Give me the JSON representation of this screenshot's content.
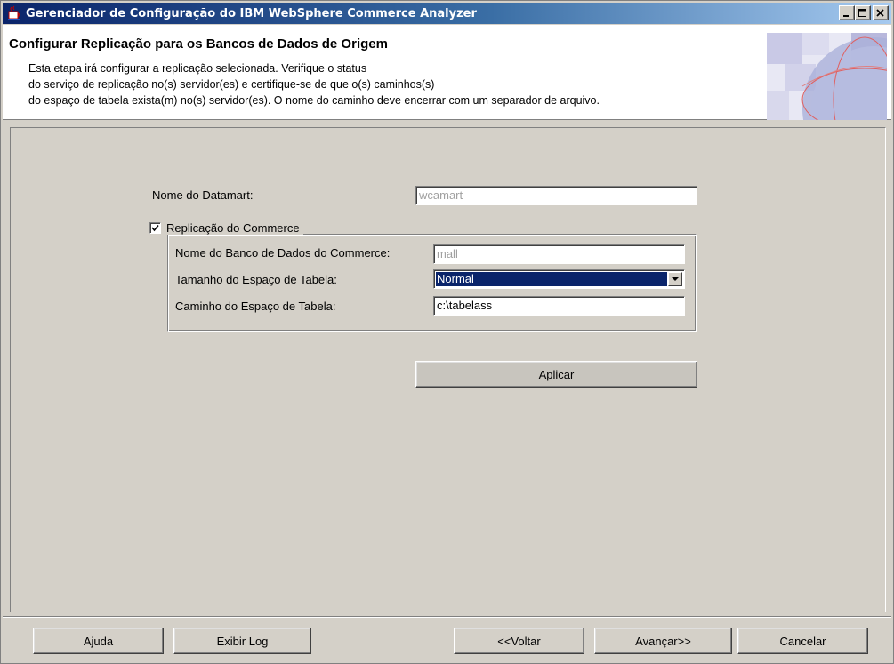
{
  "window": {
    "title": "Gerenciador de Configuração do IBM WebSphere Commerce Analyzer",
    "minimize_label": "_",
    "maximize_label": "□",
    "close_label": "X"
  },
  "header": {
    "title": "Configurar Replicação para os Bancos de Dados de Origem",
    "desc_line1": "Esta etapa irá configurar a replicação selecionada. Verifique o status",
    "desc_line2": "do serviço de replicação no(s) servidor(es) e certifique-se de que o(s) caminhos(s)",
    "desc_line3": "do espaço de tabela exista(m) no(s) servidor(es). O nome do caminho deve encerrar com um separador de arquivo."
  },
  "form": {
    "datamart_label": "Nome do Datamart:",
    "datamart_value": "wcamart",
    "replication_checkbox_label": "Replicação do Commerce",
    "replication_checked": true,
    "db_name_label": "Nome do Banco de Dados do Commerce:",
    "db_name_value": "mall",
    "tablespace_size_label": "Tamanho do Espaço de Tabela:",
    "tablespace_size_value": "Normal",
    "tablespace_path_label": "Caminho do Espaço de Tabela:",
    "tablespace_path_value": "c:\\tabelass",
    "apply_label": "Aplicar"
  },
  "footer": {
    "help_label": "Ajuda",
    "show_log_label": "Exibir Log",
    "back_label": "<<Voltar",
    "next_label": "Avançar>>",
    "cancel_label": "Cancelar"
  },
  "colors": {
    "title_bar": "#0a246a",
    "selection": "#0a246a",
    "panel": "#d4d0c8"
  }
}
